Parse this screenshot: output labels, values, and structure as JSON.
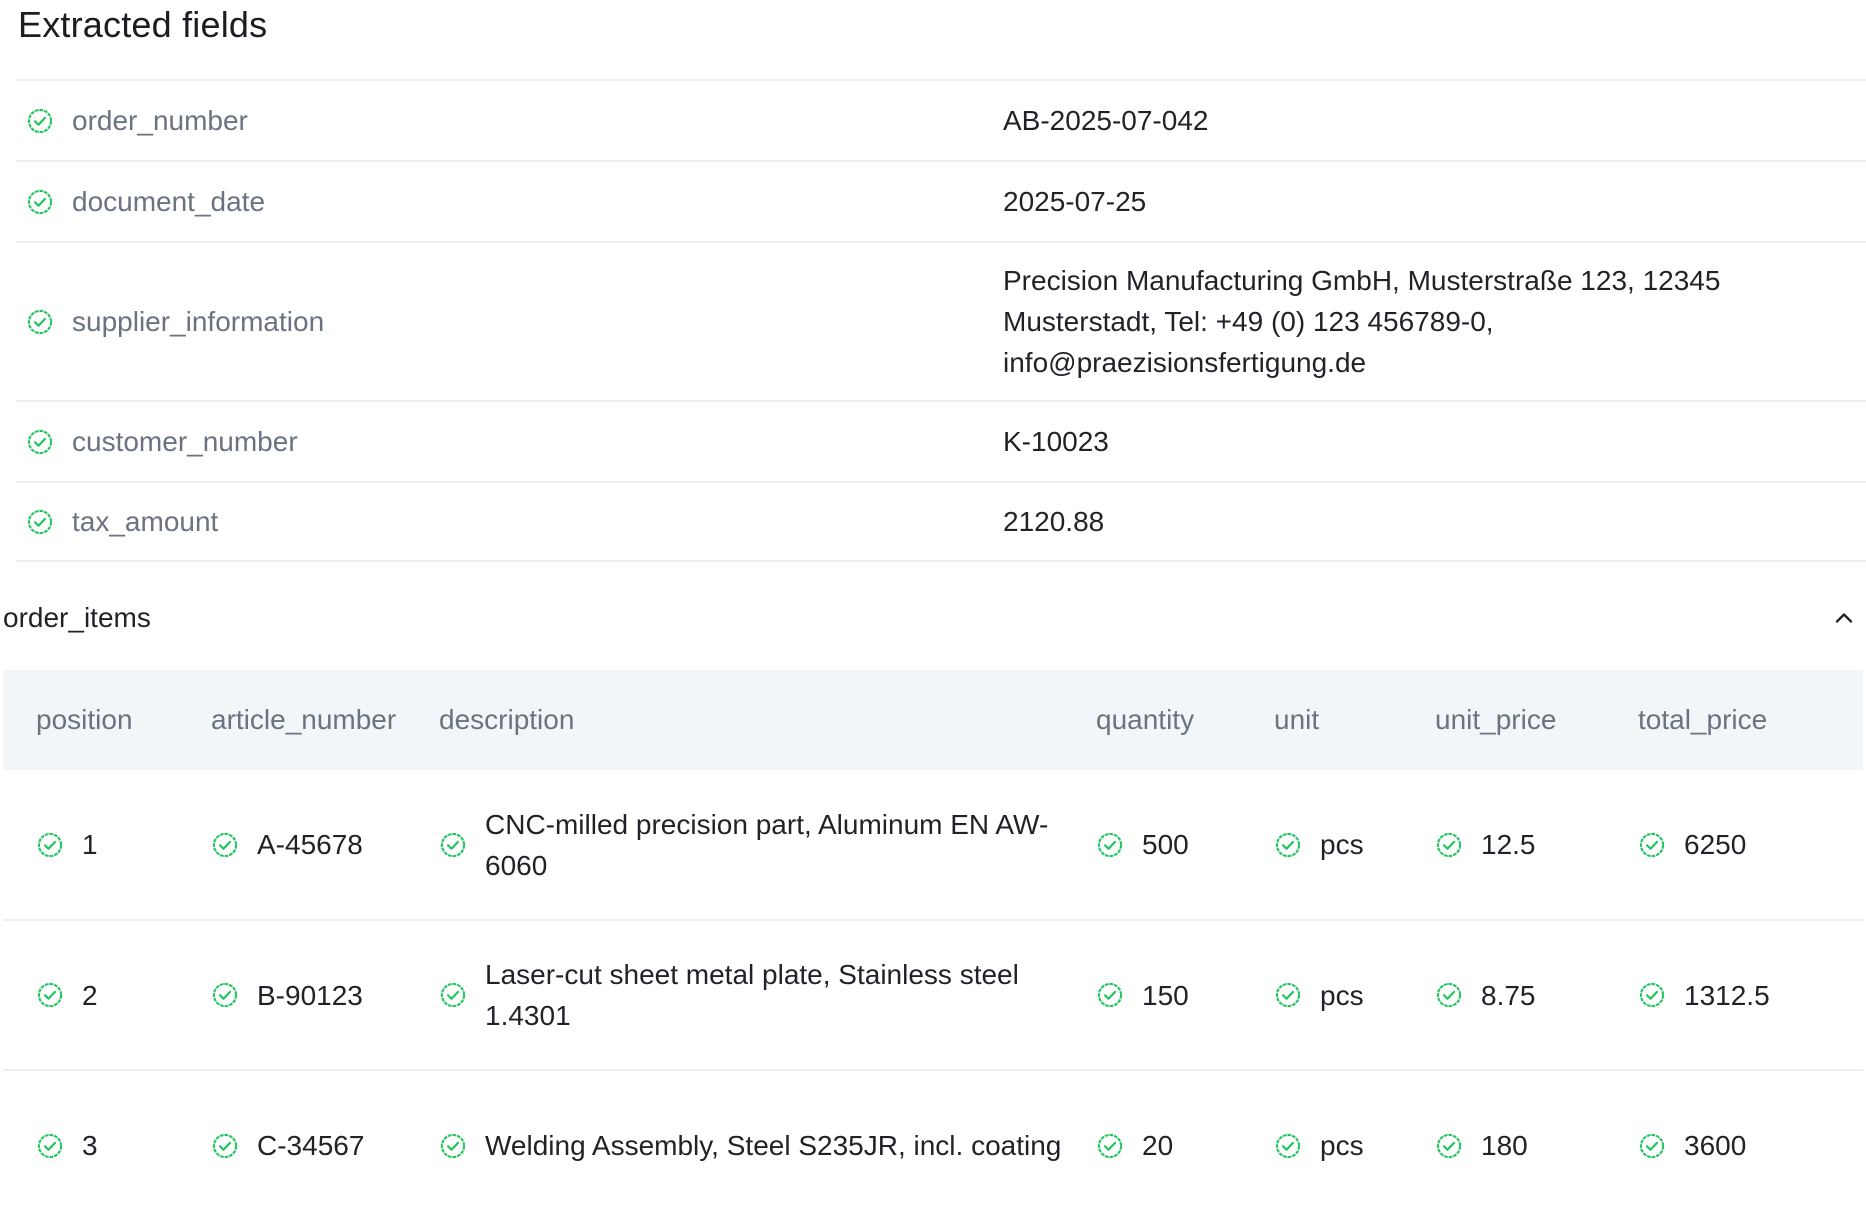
{
  "header": {
    "title": "Extracted fields"
  },
  "fields": [
    {
      "key": "order_number",
      "value": "AB-2025-07-042"
    },
    {
      "key": "document_date",
      "value": "2025-07-25"
    },
    {
      "key": "supplier_information",
      "value": "Precision Manufacturing GmbH, Musterstraße 123, 12345 Musterstadt, Tel: +49 (0) 123 456789-0, info@praezisionsfertigung.de"
    },
    {
      "key": "customer_number",
      "value": "K-10023"
    },
    {
      "key": "tax_amount",
      "value": "2120.88"
    }
  ],
  "order_items": {
    "title": "order_items",
    "columns": [
      "position",
      "article_number",
      "description",
      "quantity",
      "unit",
      "unit_price",
      "total_price"
    ],
    "rows": [
      [
        "1",
        "A-45678",
        "CNC-milled precision part, Aluminum EN AW-6060",
        "500",
        "pcs",
        "12.5",
        "6250"
      ],
      [
        "2",
        "B-90123",
        "Laser-cut sheet metal plate, Stainless steel 1.4301",
        "150",
        "pcs",
        "8.75",
        "1312.5"
      ],
      [
        "3",
        "C-34567",
        "Welding Assembly, Steel S235JR, incl. coating",
        "20",
        "pcs",
        "180",
        "3600"
      ]
    ]
  },
  "icons": {
    "status": "check-circle-icon",
    "collapse": "chevron-up-icon"
  },
  "colors": {
    "check": "#22c55e"
  }
}
